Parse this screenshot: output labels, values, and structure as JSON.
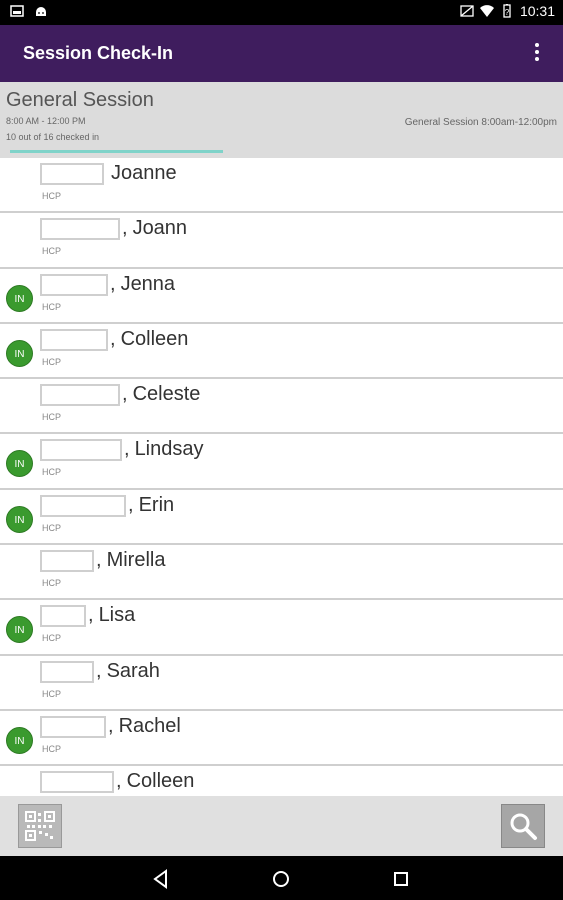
{
  "status_bar": {
    "time": "10:31",
    "left_icons": [
      "gallery-icon",
      "android-icon"
    ],
    "right_icons": [
      "no-sim-icon",
      "wifi-icon",
      "battery-icon"
    ]
  },
  "app_bar": {
    "title": "Session Check-In",
    "menu_icon": "overflow-menu-icon",
    "color": "#3f1d5e"
  },
  "session": {
    "name": "General Session",
    "time": "8:00 AM - 12:00 PM",
    "count": "10 out of 16 checked in",
    "right_label": "General Session 8:00am-12:00pm",
    "checked_in": 10,
    "total": 16,
    "progress_color": "#7fd3c9"
  },
  "attendees": [
    {
      "name": "Joanne",
      "separator": "",
      "role": "HCP",
      "checked_in": false
    },
    {
      "name": "Joann",
      "separator": ",",
      "role": "HCP",
      "checked_in": false
    },
    {
      "name": "Jenna",
      "separator": ",",
      "role": "HCP",
      "checked_in": true
    },
    {
      "name": "Colleen",
      "separator": ",",
      "role": "HCP",
      "checked_in": true
    },
    {
      "name": "Celeste",
      "separator": ",",
      "role": "HCP",
      "checked_in": false
    },
    {
      "name": "Lindsay",
      "separator": ",",
      "role": "HCP",
      "checked_in": true
    },
    {
      "name": "Erin",
      "separator": ",",
      "role": "HCP",
      "checked_in": true
    },
    {
      "name": "Mirella",
      "separator": ",",
      "role": "HCP",
      "checked_in": false
    },
    {
      "name": "Lisa",
      "separator": ",",
      "role": "HCP",
      "checked_in": true
    },
    {
      "name": "Sarah",
      "separator": ",",
      "role": "HCP",
      "checked_in": false
    },
    {
      "name": "Rachel",
      "separator": ",",
      "role": "HCP",
      "checked_in": true
    },
    {
      "name": "Colleen",
      "separator": ",",
      "role": "HCP",
      "checked_in": false
    }
  ],
  "badge": {
    "label": "IN",
    "color": "#3a9a2e"
  },
  "toolbar": {
    "qr_icon": "qr-code-icon",
    "search_icon": "search-icon"
  },
  "nav_bar": {
    "icons": [
      "back-icon",
      "home-icon",
      "recents-icon"
    ]
  }
}
